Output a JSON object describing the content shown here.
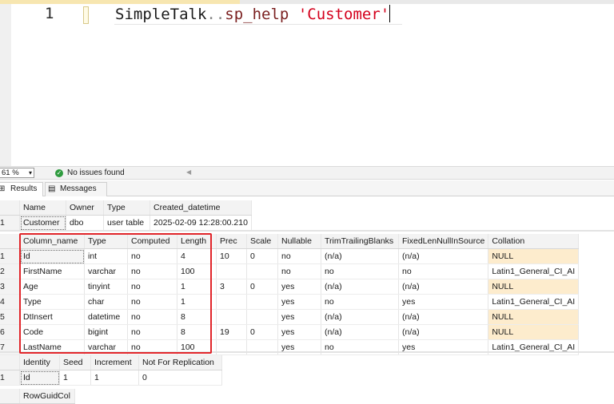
{
  "editor": {
    "line_number": "1",
    "code": {
      "object": "SimpleTalk",
      "dots": "..",
      "proc": "sp_help",
      "space": " ",
      "string": "'Customer'"
    }
  },
  "status": {
    "zoom": "61 %",
    "zoom_arrow": "▾",
    "issues": "No issues found",
    "issues_icon": "✓",
    "scroll_left": "◀"
  },
  "tabs": [
    {
      "label": "Results",
      "icon": "⊞",
      "icon_name": "grid-icon"
    },
    {
      "label": "Messages",
      "icon": "▤",
      "icon_name": "messages-icon"
    }
  ],
  "grid1": {
    "columns": [
      "Name",
      "Owner",
      "Type",
      "Created_datetime"
    ],
    "rows": [
      {
        "n": "1",
        "cells": [
          "Customer",
          "dbo",
          "user table",
          "2025-02-09 12:28:00.210"
        ]
      }
    ]
  },
  "grid2": {
    "columns": [
      "Column_name",
      "Type",
      "Computed",
      "Length",
      "Prec",
      "Scale",
      "Nullable",
      "TrimTrailingBlanks",
      "FixedLenNullInSource",
      "Collation"
    ],
    "rows": [
      {
        "n": "1",
        "cells": [
          "Id",
          "int",
          "no",
          "4",
          "10",
          "0",
          "no",
          "(n/a)",
          "(n/a)",
          "NULL"
        ]
      },
      {
        "n": "2",
        "cells": [
          "FirstName",
          "varchar",
          "no",
          "100",
          "",
          "",
          "no",
          "no",
          "no",
          "Latin1_General_CI_AI"
        ]
      },
      {
        "n": "3",
        "cells": [
          "Age",
          "tinyint",
          "no",
          "1",
          "3",
          "0",
          "yes",
          "(n/a)",
          "(n/a)",
          "NULL"
        ]
      },
      {
        "n": "4",
        "cells": [
          "Type",
          "char",
          "no",
          "1",
          "",
          "",
          "yes",
          "no",
          "yes",
          "Latin1_General_CI_AI"
        ]
      },
      {
        "n": "5",
        "cells": [
          "DtInsert",
          "datetime",
          "no",
          "8",
          "",
          "",
          "yes",
          "(n/a)",
          "(n/a)",
          "NULL"
        ]
      },
      {
        "n": "6",
        "cells": [
          "Code",
          "bigint",
          "no",
          "8",
          "19",
          "0",
          "yes",
          "(n/a)",
          "(n/a)",
          "NULL"
        ]
      },
      {
        "n": "7",
        "cells": [
          "LastName",
          "varchar",
          "no",
          "100",
          "",
          "",
          "yes",
          "no",
          "yes",
          "Latin1_General_CI_AI"
        ]
      }
    ]
  },
  "grid3": {
    "columns": [
      "Identity",
      "Seed",
      "Increment",
      "Not For Replication"
    ],
    "rows": [
      {
        "n": "1",
        "cells": [
          "Id",
          "1",
          "1",
          "0"
        ]
      }
    ]
  },
  "grid4": {
    "columns": [
      "RowGuidCol"
    ]
  },
  "colors": {
    "highlight_box": "#e1252a",
    "null_cell": "#fdeccd",
    "string": "#d4001c"
  }
}
